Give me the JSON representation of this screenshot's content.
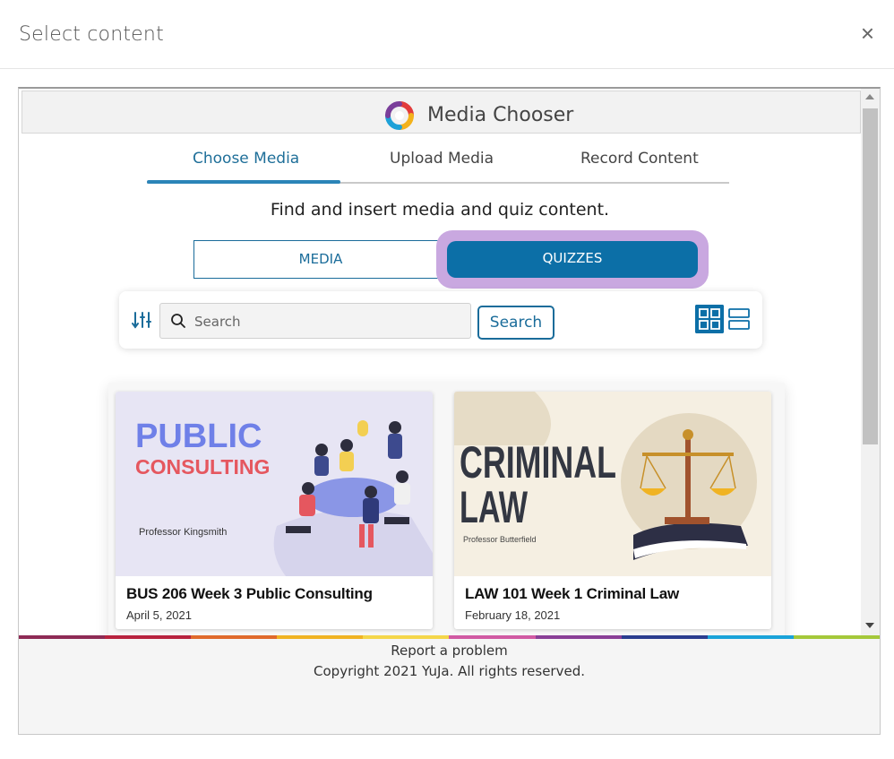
{
  "modal": {
    "title": "Select content",
    "close_label": "×"
  },
  "chooser": {
    "title": "Media Chooser",
    "tabs": [
      {
        "label": "Choose Media",
        "active": true
      },
      {
        "label": "Upload Media",
        "active": false
      },
      {
        "label": "Record Content",
        "active": false
      }
    ],
    "instruction": "Find and insert media and quiz content.",
    "segments": {
      "media_label": "MEDIA",
      "quizzes_label": "QUIZZES",
      "selected": "QUIZZES"
    },
    "search": {
      "placeholder": "Search",
      "value": "",
      "button_label": "Search"
    },
    "view_mode": "grid"
  },
  "cards": [
    {
      "title": "BUS 206 Week 3 Public Consulting",
      "date": "April 5, 2021",
      "thumb_heading_1": "PUBLIC",
      "thumb_heading_2": "CONSULTING",
      "thumb_professor": "Professor Kingsmith"
    },
    {
      "title": "LAW 101 Week 1 Criminal Law",
      "date": "February 18, 2021",
      "thumb_heading_1": "CRIMINAL",
      "thumb_heading_2": "LAW",
      "thumb_professor": "Professor Butterfield"
    }
  ],
  "footer": {
    "report_label": "Report a problem",
    "copyright": "Copyright 2021 YuJa. All rights reserved.",
    "rainbow_colors": [
      "#8e2b55",
      "#b8233f",
      "#e06a2b",
      "#f0b323",
      "#f4d64a",
      "#d15aa3",
      "#8a3f97",
      "#2a3d8f",
      "#1aa3d9",
      "#a5c83a"
    ]
  },
  "colors": {
    "accent": "#0c6fa7",
    "quiz_highlight": "#c9a8e0"
  }
}
